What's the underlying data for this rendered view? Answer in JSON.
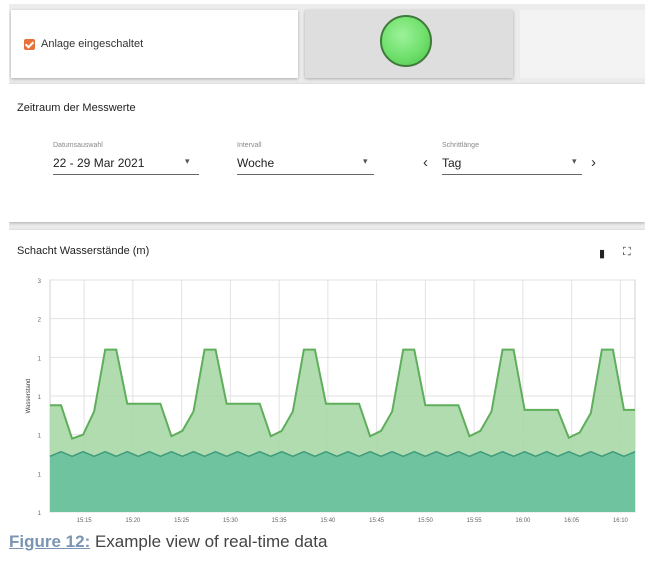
{
  "plant": {
    "enabled_label": "Anlage eingeschaltet",
    "enabled": true,
    "status_color": "#6fe06b"
  },
  "range": {
    "title": "Zeitraum der Messwerte",
    "date": {
      "label": "Datumsauswahl",
      "value": "22 - 29 Mar 2021"
    },
    "interval": {
      "label": "Intervall",
      "value": "Woche"
    },
    "step": {
      "label": "Schrittlänge",
      "value": "Tag"
    },
    "prev_symbol": "‹",
    "next_symbol": "›"
  },
  "chart_section": {
    "title": "Schacht Wasserstände (m)"
  },
  "chart_data": {
    "type": "area",
    "title": "Schacht Wasserstände (m)",
    "ylabel": "Wasserstand",
    "ylim": [
      0,
      3
    ],
    "yticks": [
      "3",
      "2",
      "1",
      "1",
      "1",
      "1",
      "1"
    ],
    "xticks": [
      "15:15",
      "15:20",
      "15:25",
      "15:30",
      "15:35",
      "15:40",
      "15:45",
      "15:50",
      "15:55",
      "16:00",
      "16:05",
      "16:10"
    ],
    "colors": {
      "upper": "#a9d8a6",
      "upper_line": "#5fae5b",
      "lower": "#6fc39e",
      "lower_line": "#3f9b7c"
    },
    "series": [
      {
        "values": [
          1.38,
          1.38,
          0.95,
          1.0,
          1.3,
          2.1,
          2.1,
          1.4,
          1.4,
          1.4,
          1.4,
          0.98,
          1.05,
          1.3,
          2.1,
          2.1,
          1.4,
          1.4,
          1.4,
          1.4,
          0.98,
          1.05,
          1.3,
          2.1,
          2.1,
          1.4,
          1.4,
          1.4,
          1.4,
          0.98,
          1.05,
          1.3,
          2.1,
          2.1,
          1.38,
          1.38,
          1.38,
          1.38,
          0.98,
          1.05,
          1.3,
          2.1,
          2.1,
          1.32,
          1.32,
          1.32,
          1.32,
          0.96,
          1.03,
          1.28,
          2.1,
          2.1,
          1.32,
          1.32
        ]
      },
      {
        "values": [
          0.72,
          0.78,
          0.72,
          0.78,
          0.72,
          0.78,
          0.72,
          0.78,
          0.72,
          0.78,
          0.72,
          0.78,
          0.72,
          0.78,
          0.72,
          0.78,
          0.72,
          0.78,
          0.72,
          0.78,
          0.72,
          0.78,
          0.72,
          0.78,
          0.72,
          0.78,
          0.72,
          0.78,
          0.72,
          0.78,
          0.72,
          0.78,
          0.72,
          0.78,
          0.72,
          0.78,
          0.72,
          0.78,
          0.72,
          0.78,
          0.72,
          0.78,
          0.72,
          0.78,
          0.72,
          0.78,
          0.72,
          0.78,
          0.72,
          0.78,
          0.72,
          0.78,
          0.72,
          0.78
        ]
      }
    ]
  },
  "caption": {
    "figure": "Figure 12:",
    "text": " Example view of real-time data"
  }
}
